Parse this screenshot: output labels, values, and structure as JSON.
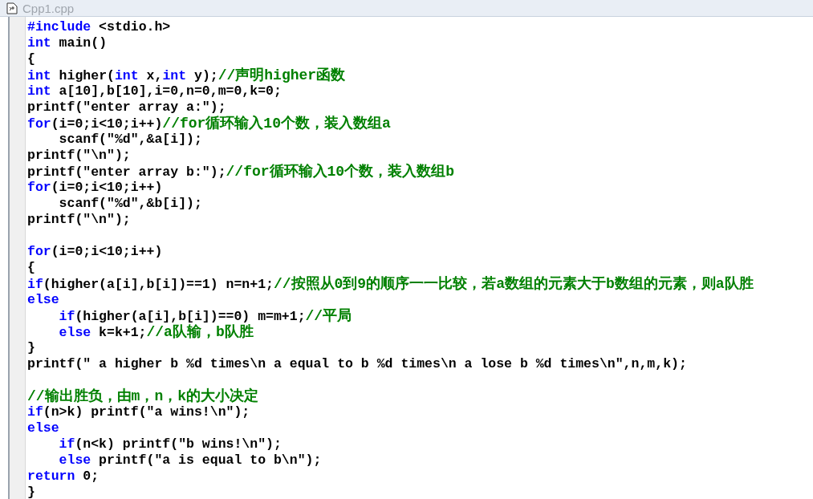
{
  "window": {
    "title": "Cpp1.cpp"
  },
  "lines": [
    {
      "kind": "code",
      "segments": [
        {
          "kind": "keyword",
          "text": "#include"
        },
        {
          "kind": "plain",
          "text": " <stdio.h>"
        }
      ]
    },
    {
      "kind": "code",
      "segments": [
        {
          "kind": "keyword",
          "text": "int"
        },
        {
          "kind": "plain",
          "text": " main()"
        }
      ]
    },
    {
      "kind": "code",
      "segments": [
        {
          "kind": "plain",
          "text": "{"
        }
      ]
    },
    {
      "kind": "code",
      "segments": [
        {
          "kind": "keyword",
          "text": "int"
        },
        {
          "kind": "plain",
          "text": " higher("
        },
        {
          "kind": "keyword",
          "text": "int"
        },
        {
          "kind": "plain",
          "text": " x,"
        },
        {
          "kind": "keyword",
          "text": "int"
        },
        {
          "kind": "plain",
          "text": " y);"
        },
        {
          "kind": "comment",
          "text": "//声明higher函数"
        }
      ]
    },
    {
      "kind": "code",
      "segments": [
        {
          "kind": "keyword",
          "text": "int"
        },
        {
          "kind": "plain",
          "text": " a[10],b[10],i=0,n=0,m=0,k=0;"
        }
      ]
    },
    {
      "kind": "code",
      "segments": [
        {
          "kind": "plain",
          "text": "printf(\"enter array a:\");"
        }
      ]
    },
    {
      "kind": "code",
      "segments": [
        {
          "kind": "keyword",
          "text": "for"
        },
        {
          "kind": "plain",
          "text": "(i=0;i<10;i++)"
        },
        {
          "kind": "comment",
          "text": "//for循环输入10个数，装入数组a"
        }
      ]
    },
    {
      "kind": "code",
      "segments": [
        {
          "kind": "plain",
          "text": "    scanf(\"%d\",&a[i]);"
        }
      ]
    },
    {
      "kind": "code",
      "segments": [
        {
          "kind": "plain",
          "text": "printf(\"\\n\");"
        }
      ]
    },
    {
      "kind": "code",
      "segments": [
        {
          "kind": "plain",
          "text": "printf(\"enter array b:\");"
        },
        {
          "kind": "comment",
          "text": "//for循环输入10个数，装入数组b"
        }
      ]
    },
    {
      "kind": "code",
      "segments": [
        {
          "kind": "keyword",
          "text": "for"
        },
        {
          "kind": "plain",
          "text": "(i=0;i<10;i++)"
        }
      ]
    },
    {
      "kind": "code",
      "segments": [
        {
          "kind": "plain",
          "text": "    scanf(\"%d\",&b[i]);"
        }
      ]
    },
    {
      "kind": "code",
      "segments": [
        {
          "kind": "plain",
          "text": "printf(\"\\n\");"
        }
      ]
    },
    {
      "kind": "blank"
    },
    {
      "kind": "code",
      "segments": [
        {
          "kind": "keyword",
          "text": "for"
        },
        {
          "kind": "plain",
          "text": "(i=0;i<10;i++)"
        }
      ]
    },
    {
      "kind": "code",
      "segments": [
        {
          "kind": "plain",
          "text": "{"
        }
      ]
    },
    {
      "kind": "code",
      "segments": [
        {
          "kind": "keyword",
          "text": "if"
        },
        {
          "kind": "plain",
          "text": "(higher(a[i],b[i])==1) n=n+1;"
        },
        {
          "kind": "comment",
          "text": "//按照从0到9的顺序一一比较，若a数组的元素大于b数组的元素，则a队胜"
        }
      ]
    },
    {
      "kind": "code",
      "segments": [
        {
          "kind": "keyword",
          "text": "else"
        }
      ]
    },
    {
      "kind": "code",
      "indented": true,
      "segments": [
        {
          "kind": "keyword",
          "text": "if"
        },
        {
          "kind": "plain",
          "text": "(higher(a[i],b[i])==0) m=m+1;"
        },
        {
          "kind": "comment",
          "text": "//平局"
        }
      ]
    },
    {
      "kind": "code",
      "indented": true,
      "segments": [
        {
          "kind": "keyword",
          "text": "else"
        },
        {
          "kind": "plain",
          "text": " k=k+1;"
        },
        {
          "kind": "comment",
          "text": "//a队输，b队胜"
        }
      ]
    },
    {
      "kind": "code",
      "segments": [
        {
          "kind": "plain",
          "text": "}"
        }
      ]
    },
    {
      "kind": "code",
      "segments": [
        {
          "kind": "plain",
          "text": "printf(\" a higher b %d times\\n a equal to b %d times\\n a lose b %d times\\n\",n,m,k);"
        }
      ]
    },
    {
      "kind": "blank"
    },
    {
      "kind": "code",
      "segments": [
        {
          "kind": "comment",
          "text": "//输出胜负，由m，n，k的大小决定"
        }
      ]
    },
    {
      "kind": "code",
      "segments": [
        {
          "kind": "keyword",
          "text": "if"
        },
        {
          "kind": "plain",
          "text": "(n>k) printf(\"a wins!\\n\");"
        }
      ]
    },
    {
      "kind": "code",
      "segments": [
        {
          "kind": "keyword",
          "text": "else"
        }
      ]
    },
    {
      "kind": "code",
      "indented": true,
      "segments": [
        {
          "kind": "keyword",
          "text": "if"
        },
        {
          "kind": "plain",
          "text": "(n<k) printf(\"b wins!\\n\");"
        }
      ]
    },
    {
      "kind": "code",
      "indented": true,
      "segments": [
        {
          "kind": "keyword",
          "text": "else"
        },
        {
          "kind": "plain",
          "text": " printf(\"a is equal to b\\n\");"
        }
      ]
    },
    {
      "kind": "code",
      "segments": [
        {
          "kind": "keyword",
          "text": "return"
        },
        {
          "kind": "plain",
          "text": " 0;"
        }
      ]
    },
    {
      "kind": "code",
      "segments": [
        {
          "kind": "plain",
          "text": "}"
        }
      ]
    }
  ]
}
